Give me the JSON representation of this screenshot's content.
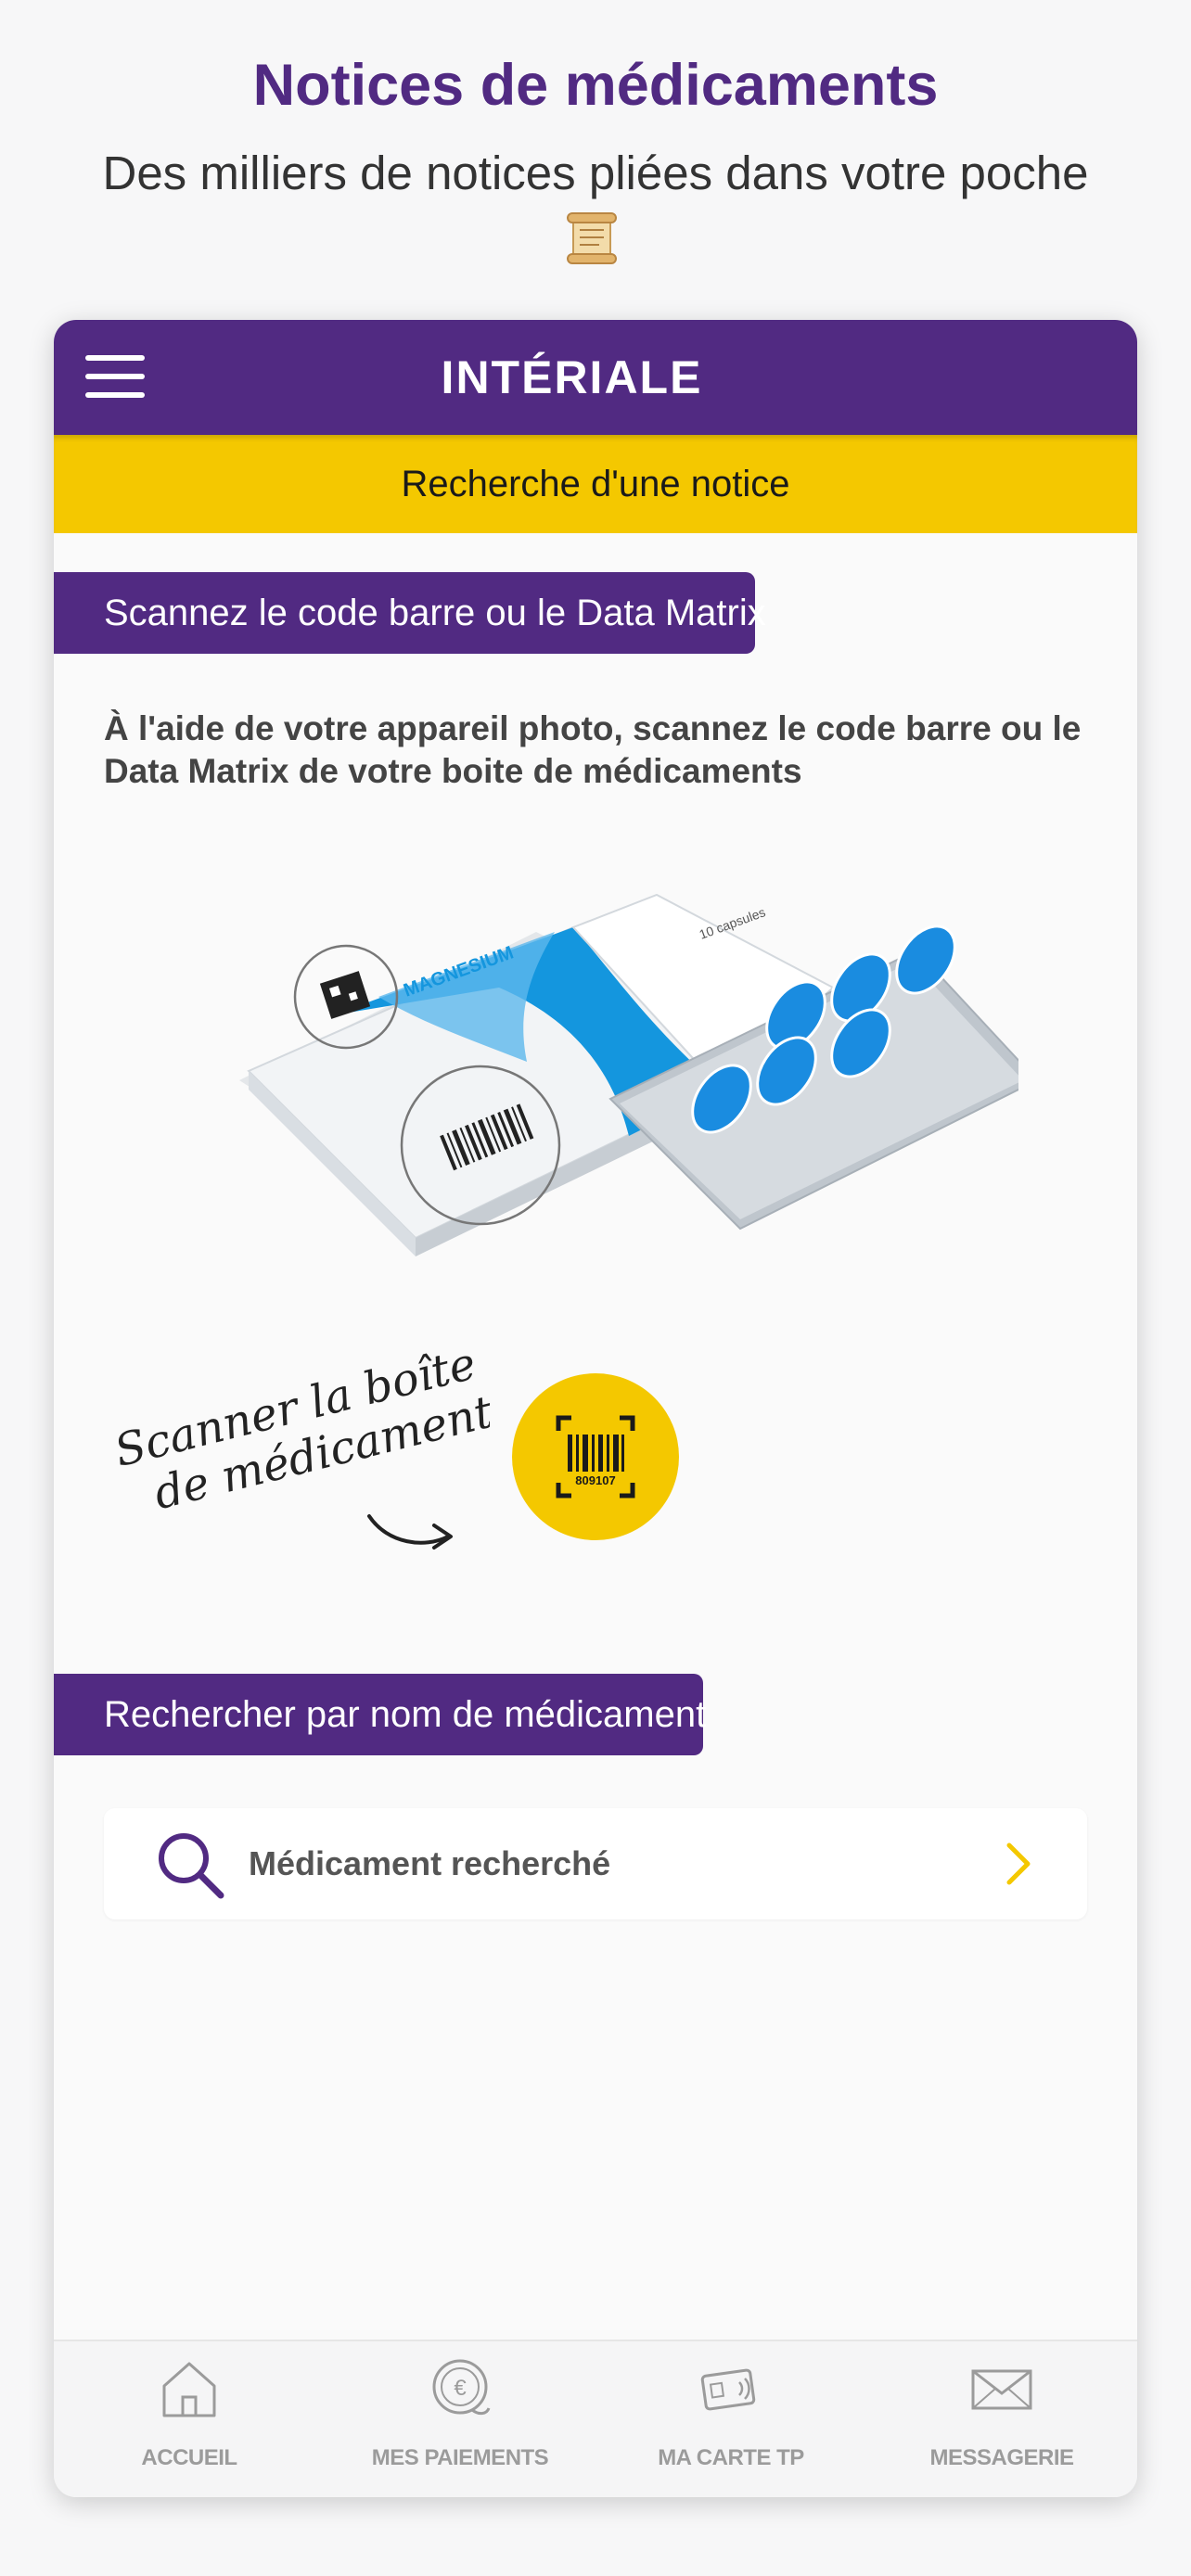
{
  "promo": {
    "title": "Notices de médicaments",
    "subtitle": "Des milliers de notices pliées dans votre poche",
    "emoji_icon": "scroll-icon"
  },
  "app": {
    "brand": "INTÉRIALE",
    "header_color": "#512a82",
    "accent_color": "#f4c800",
    "page_title": "Recherche d'une notice"
  },
  "scan_section": {
    "heading": "Scannez le code barre ou le Data Matrix",
    "description": "À l'aide de votre appareil photo, scannez le code barre ou le Data Matrix de votre boite de médicaments",
    "box_brand": "MAGNESIUM",
    "box_count": "10 capsules",
    "handwritten_line1": "Scanner la boîte",
    "handwritten_line2": "de médicaments",
    "barcode_number": "809107"
  },
  "name_section": {
    "heading": "Rechercher par nom de médicament",
    "search_placeholder": "Médicament recherché"
  },
  "bottom_nav": {
    "items": [
      {
        "label": "ACCUEIL",
        "icon": "home-icon"
      },
      {
        "label": "MES PAIEMENTS",
        "icon": "euro-coin-icon"
      },
      {
        "label": "MA CARTE TP",
        "icon": "card-contactless-icon"
      },
      {
        "label": "MESSAGERIE",
        "icon": "envelope-icon"
      }
    ]
  }
}
